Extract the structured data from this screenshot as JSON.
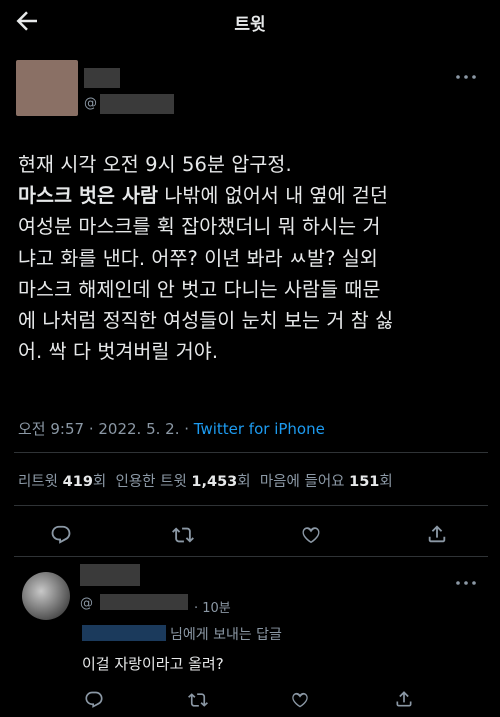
{
  "header": {
    "title": "트윗",
    "back_icon": "arrow-left-icon"
  },
  "tweet": {
    "handle_prefix": "@",
    "text_bold": "마스크 벗은 사람",
    "text_line1": "현재 시각 오전 9시 56분 압구정.",
    "text_rest_line2": " 나밖에 없어서 내 옆에 걷던",
    "text_lines_after": "여성분 마스크를 휙 잡아챘더니 뭐 하시는 거\n냐고 화를 낸다. 어쭈? 이년 봐라 ㅆ발? 실외\n마스크 해제인데 안 벗고 다니는 사람들 때문\n에 나처럼 정직한 여성들이 눈치 보는 거 참 싫\n어. 싹 다 벗겨버릴 거야.",
    "timestamp": "오전 9:57 · 2022. 5. 2. · ",
    "source": "Twitter for iPhone",
    "stats": {
      "retweets_label": "리트윗",
      "retweets": "419",
      "retweets_unit": "회",
      "quotes_label": "인용한 트윗",
      "quotes": "1,453",
      "quotes_unit": "회",
      "likes_label": "마음에 들어요",
      "likes": "151",
      "likes_unit": "회"
    }
  },
  "reply": {
    "handle_prefix": "@",
    "time": "· 10분",
    "reply_to_suffix": "님에게 보내는 답글",
    "text": "이걸 자랑이라고 올려?"
  },
  "colors": {
    "background": "#000000",
    "text": "#e7e9ea",
    "muted": "#8b98a5",
    "link": "#1d9bf0",
    "divider": "#2f3336"
  }
}
